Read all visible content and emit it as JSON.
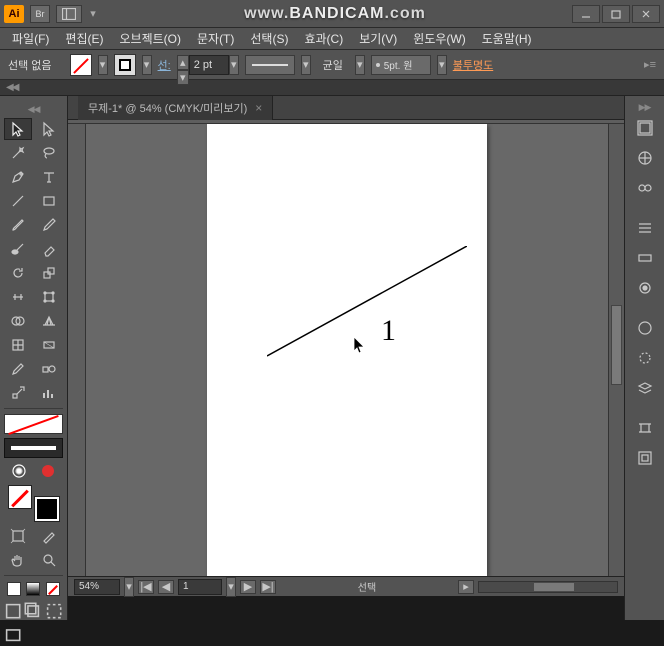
{
  "app": {
    "logo_text": "Ai",
    "bridge_text": "Br"
  },
  "watermark": {
    "prefix": "www.",
    "main": "BANDICAM",
    "suffix": ".com"
  },
  "menu": {
    "file": "파일(F)",
    "edit": "편집(E)",
    "object": "오브젝트(O)",
    "type": "문자(T)",
    "select": "선택(S)",
    "effect": "효과(C)",
    "view": "보기(V)",
    "window": "윈도우(W)",
    "help": "도움말(H)"
  },
  "control": {
    "selection": "선택 없음",
    "stroke_label": "선:",
    "stroke_weight": "2 pt",
    "profile_label": "균일",
    "brush_label": "5pt. 원",
    "opacity_label": "불투명도"
  },
  "doc": {
    "tab_title": "무제-1* @ 54% (CMYK/미리보기)",
    "tab_close": "×"
  },
  "canvas": {
    "digit": "1"
  },
  "status": {
    "zoom": "54%",
    "page": "1",
    "mode": "선택",
    "nav_first": "|◀",
    "nav_prev": "◀",
    "nav_next": "▶",
    "nav_last": "▶|",
    "sep": "▸"
  },
  "glyph": {
    "dd": "▾",
    "tri_up": "▴",
    "tri_down": "▾",
    "collapse": "◀◀",
    "menu_tri": "▸≡"
  }
}
